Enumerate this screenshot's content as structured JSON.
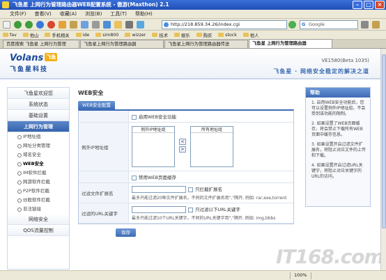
{
  "window": {
    "title": "飞鱼星 上网行为管理路由器WEB配置系统 - 傲游(Maxthon) 2.1"
  },
  "menubar": [
    "文件(F)",
    "查看(V)",
    "收藏(A)",
    "浏览(B)",
    "工具(T)",
    "帮助(H)"
  ],
  "toolbar": {
    "address": "http://218.859.34.26/index.cgi",
    "search_placeholder": "Google"
  },
  "favorites": [
    "fav",
    "他山",
    "手机相关",
    "ide",
    "sim800",
    "wizzer",
    "技术",
    "娱乐",
    "购买",
    "stock",
    "他人"
  ],
  "browser_tabs": [
    {
      "label": "百度搜索 飞鱼星 上网行为管理",
      "active": false
    },
    {
      "label": "飞鱼星上网行为管理路由器",
      "active": false
    },
    {
      "label": "飞鱼星上网行为管理路由器传送",
      "active": false
    },
    {
      "label": "飞鱼星 上网行为管理路由器",
      "active": true
    }
  ],
  "header": {
    "brand": "Volans",
    "brand_badge": "飞鱼",
    "brand_cn": "飞鱼星科技",
    "version": "VE1580(Beta 1035)",
    "slogan": "飞鱼星 · 网络安全稳定的解决之道"
  },
  "sidebar": {
    "top_items": [
      "飞鱼星欢迎您",
      "系统状态",
      "基础设置"
    ],
    "active_item": "上网行为管理",
    "sub_items": [
      "IP地址组",
      "网址分类管理",
      "域名安全",
      "WEB安全",
      "IM软件拦截",
      "网游软件拦截",
      "P2P软件拦截",
      "炒股软件拦截",
      "非法链接"
    ],
    "current_sub": "WEB安全",
    "bottom_items": [
      "网络安全",
      "QOS流量控制"
    ]
  },
  "main": {
    "title": "WEB安全",
    "section_tab": "WEB安全配置",
    "enable_label": "启用WEB安全功能",
    "source_ip_label": "例外IP地址组",
    "list_left_header": "例外IP地址组",
    "list_right_header": "所有地址组",
    "move_left": "<",
    "move_right": ">",
    "block_cookie_label": "禁用WEB页面缓存",
    "ext_label": "过滤文件扩展名",
    "ext_check_label": "只拦截扩展名",
    "ext_hint": "最多只能过滤20种文件扩展名。不同的文件扩展名用\",\"隔开, 例如: rar,exe,torrent",
    "url_label": "过滤的URL关键字",
    "url_check_label": "只过滤以下URL关键字",
    "url_hint": "最多只能过滤10个URL关键字。不同的URL关键字用\",\"隔开, 例如: img,bbbs",
    "save_label": "保存"
  },
  "help": {
    "title": "帮助",
    "items": [
      "1. 启用WEB安全功能后，您可以设置例外IP地址组，不会受到该功能的限制。",
      "2. 如果设置了WEB页面缓存，将会禁止下载所有WEB页面中缓存信息。",
      "3. 如果设置开启过滤文件扩展名，将阻止对应文件的上传和下载。",
      "4. 如果设置开启过滤URL关键字，将阻止对应关键字的URL的访问。"
    ]
  },
  "watermark": "IT168.com",
  "status": {
    "zoom": "100%"
  }
}
